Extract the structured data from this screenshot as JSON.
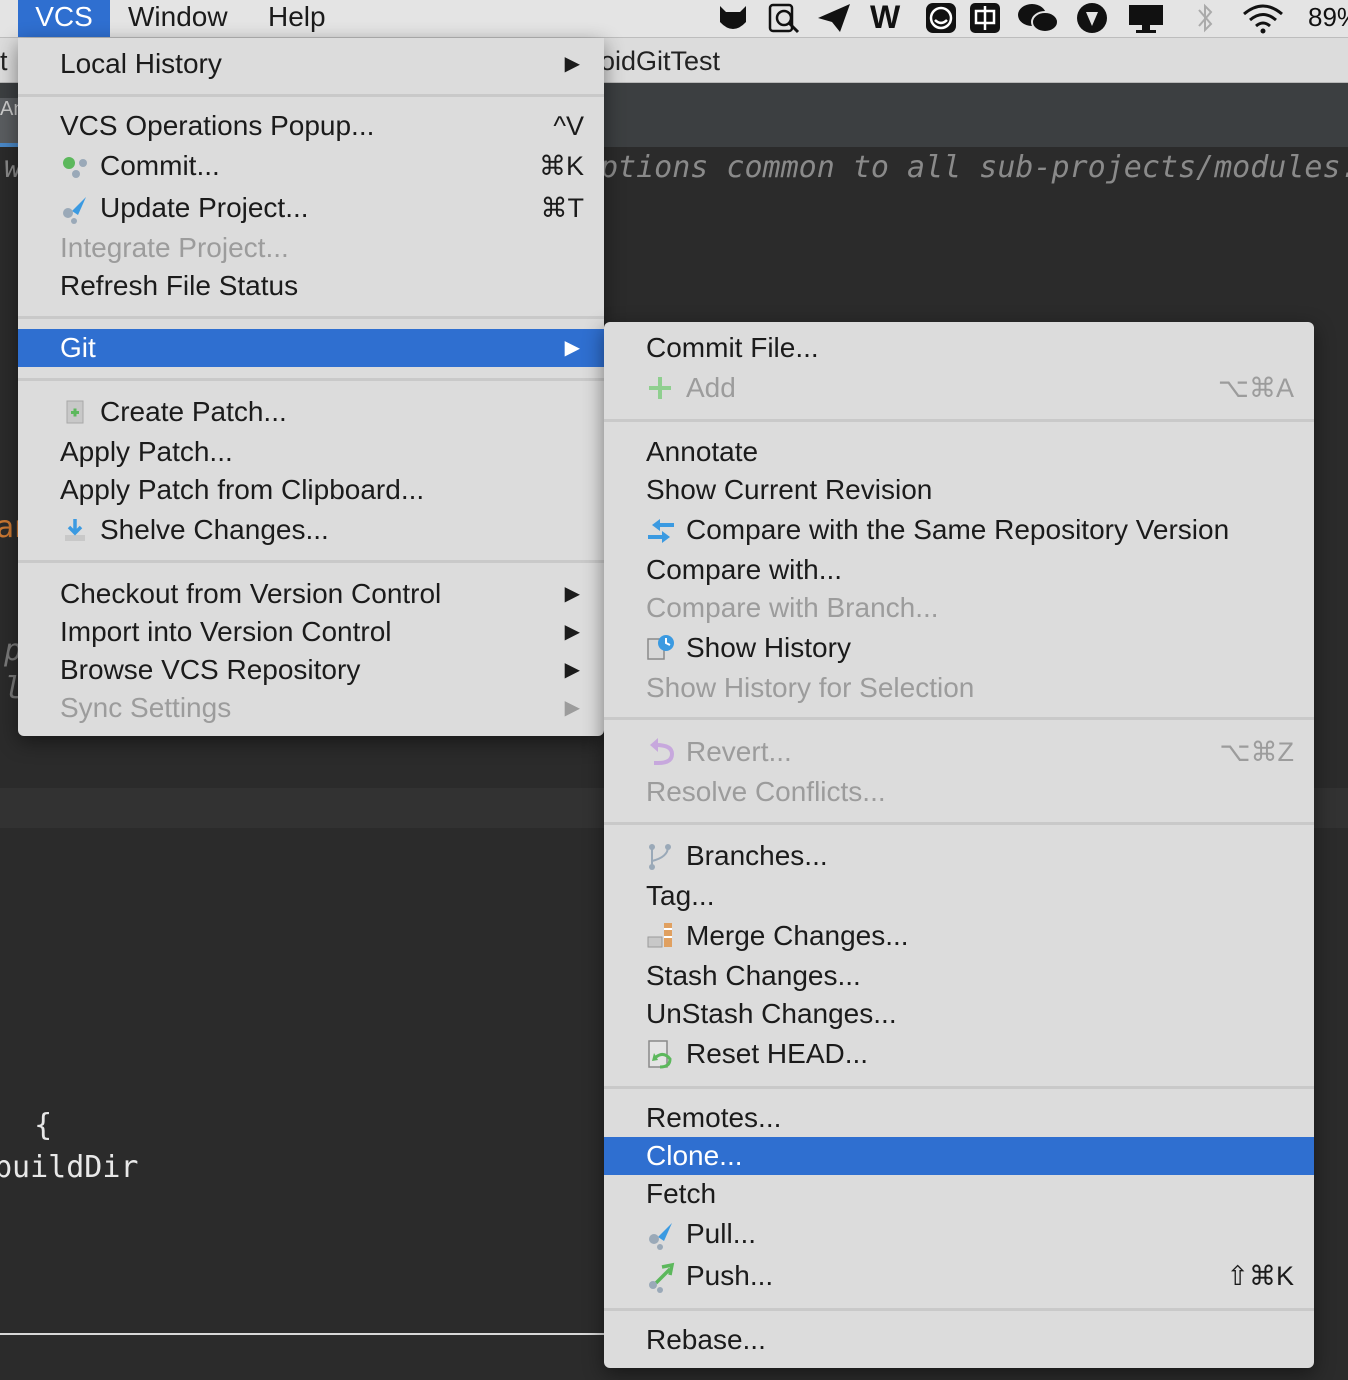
{
  "menubar": {
    "items": [
      "VCS",
      "Window",
      "Help"
    ],
    "battery": "89%"
  },
  "ide": {
    "title_fragment": "oidGitTest",
    "title_left_fragment": "t",
    "tab_fragment": "An",
    "comment_fragment": "ptions common to all sub-projects/modules.",
    "comment_left": "w",
    "code_an": "an",
    "code_p1": "p",
    "code_p2": "ld",
    "code_brace": "  {",
    "code_builddir": "buildDir"
  },
  "vcs_menu": {
    "local_history": "Local History",
    "vcs_ops_popup": "VCS Operations Popup...",
    "vcs_ops_popup_sc": "^V",
    "commit": "Commit...",
    "commit_sc": "⌘K",
    "update_project": "Update Project...",
    "update_project_sc": "⌘T",
    "integrate_project": "Integrate Project...",
    "refresh_file_status": "Refresh File Status",
    "git": "Git",
    "create_patch": "Create Patch...",
    "apply_patch": "Apply Patch...",
    "apply_patch_clipboard": "Apply Patch from Clipboard...",
    "shelve_changes": "Shelve Changes...",
    "checkout_vc": "Checkout from Version Control",
    "import_vc": "Import into Version Control",
    "browse_vcs": "Browse VCS Repository",
    "sync_settings": "Sync Settings"
  },
  "git_menu": {
    "commit_file": "Commit File...",
    "add": "Add",
    "add_sc": "⌥⌘A",
    "annotate": "Annotate",
    "show_current_revision": "Show Current Revision",
    "compare_same_repo": "Compare with the Same Repository Version",
    "compare_with": "Compare with...",
    "compare_with_branch": "Compare with Branch...",
    "show_history": "Show History",
    "show_history_selection": "Show History for Selection",
    "revert": "Revert...",
    "revert_sc": "⌥⌘Z",
    "resolve_conflicts": "Resolve Conflicts...",
    "branches": "Branches...",
    "tag": "Tag...",
    "merge_changes": "Merge Changes...",
    "stash_changes": "Stash Changes...",
    "unstash_changes": "UnStash Changes...",
    "reset_head": "Reset HEAD...",
    "remotes": "Remotes...",
    "clone": "Clone...",
    "fetch": "Fetch",
    "pull": "Pull...",
    "push": "Push...",
    "push_sc": "⇧⌘K",
    "rebase": "Rebase..."
  }
}
